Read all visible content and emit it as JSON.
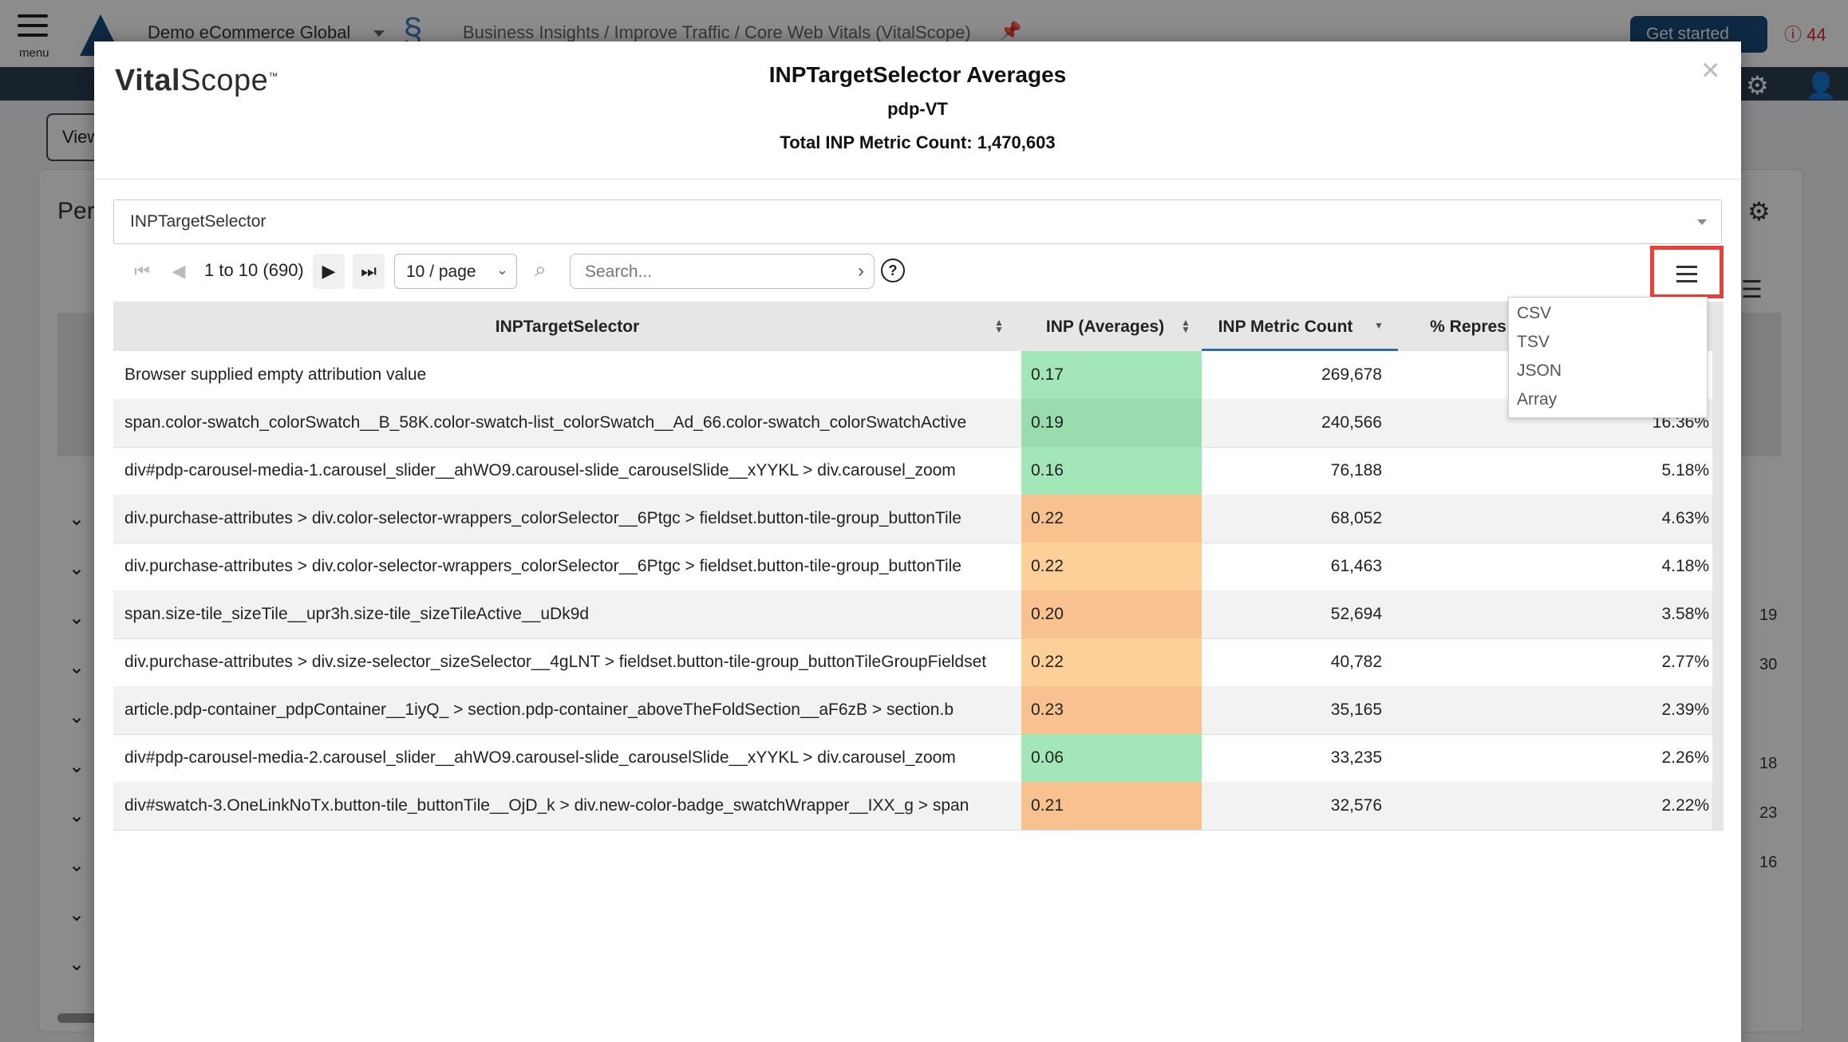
{
  "background": {
    "menu_label": "menu",
    "company": "Demo eCommerce Global",
    "breadcrumb": "Business Insights / Improve Traffic / Core Web Vitals (VitalScope)",
    "get_started": "Get started",
    "alert_count": "44",
    "view_button": "View",
    "page_title_fragment": "Per",
    "side_numbers": [
      "19",
      "30",
      "18",
      "23",
      "16"
    ]
  },
  "modal": {
    "brand_bold": "Vital",
    "brand_rest": "Scope",
    "title": "INPTargetSelector Averages",
    "subtitle": "pdp-VT",
    "total": "Total INP Metric Count: 1,470,603",
    "dimension_select": "INPTargetSelector",
    "pager": {
      "range": "1 to 10 (690)",
      "per_page": "10 / page",
      "search_placeholder": "Search..."
    },
    "export_menu": [
      "CSV",
      "TSV",
      "JSON",
      "Array"
    ],
    "columns": {
      "selector": "INPTargetSelector",
      "inp": "INP (Averages)",
      "count": "INP Metric Count",
      "pct": "% Repres"
    },
    "rows": [
      {
        "selector": "Browser supplied empty attribution value",
        "inp": "0.17",
        "count": "269,678",
        "pct": ""
      },
      {
        "selector": "span.color-swatch_colorSwatch__B_58K.color-swatch-list_colorSwatch__Ad_66.color-swatch_colorSwatchActive",
        "inp": "0.19",
        "count": "240,566",
        "pct": "16.36%"
      },
      {
        "selector": "div#pdp-carousel-media-1.carousel_slider__ahWO9.carousel-slide_carouselSlide__xYYKL > div.carousel_zoom",
        "inp": "0.16",
        "count": "76,188",
        "pct": "5.18%"
      },
      {
        "selector": "div.purchase-attributes > div.color-selector-wrappers_colorSelector__6Ptgc > fieldset.button-tile-group_buttonTile",
        "inp": "0.22",
        "count": "68,052",
        "pct": "4.63%"
      },
      {
        "selector": "div.purchase-attributes > div.color-selector-wrappers_colorSelector__6Ptgc > fieldset.button-tile-group_buttonTile",
        "inp": "0.22",
        "count": "61,463",
        "pct": "4.18%"
      },
      {
        "selector": "span.size-tile_sizeTile__upr3h.size-tile_sizeTileActive__uDk9d",
        "inp": "0.20",
        "count": "52,694",
        "pct": "3.58%"
      },
      {
        "selector": "div.purchase-attributes > div.size-selector_sizeSelector__4gLNT > fieldset.button-tile-group_buttonTileGroupFieldset",
        "inp": "0.22",
        "count": "40,782",
        "pct": "2.77%"
      },
      {
        "selector": "article.pdp-container_pdpContainer__1iyQ_ > section.pdp-container_aboveTheFoldSection__aF6zB > section.b",
        "inp": "0.23",
        "count": "35,165",
        "pct": "2.39%"
      },
      {
        "selector": "div#pdp-carousel-media-2.carousel_slider__ahWO9.carousel-slide_carouselSlide__xYYKL > div.carousel_zoom",
        "inp": "0.06",
        "count": "33,235",
        "pct": "2.26%"
      },
      {
        "selector": "div#swatch-3.OneLinkNoTx.button-tile_buttonTile__OjD_k > div.new-color-badge_swatchWrapper__IXX_g > span",
        "inp": "0.21",
        "count": "32,576",
        "pct": "2.22%"
      }
    ]
  },
  "colors": {
    "good": "#a3e6b8",
    "good_dark": "#99dcae",
    "warn": "#fdd09a",
    "warn_dark": "#f7c28f",
    "highlight": "#e8403a",
    "brand": "#1a4c7a"
  }
}
